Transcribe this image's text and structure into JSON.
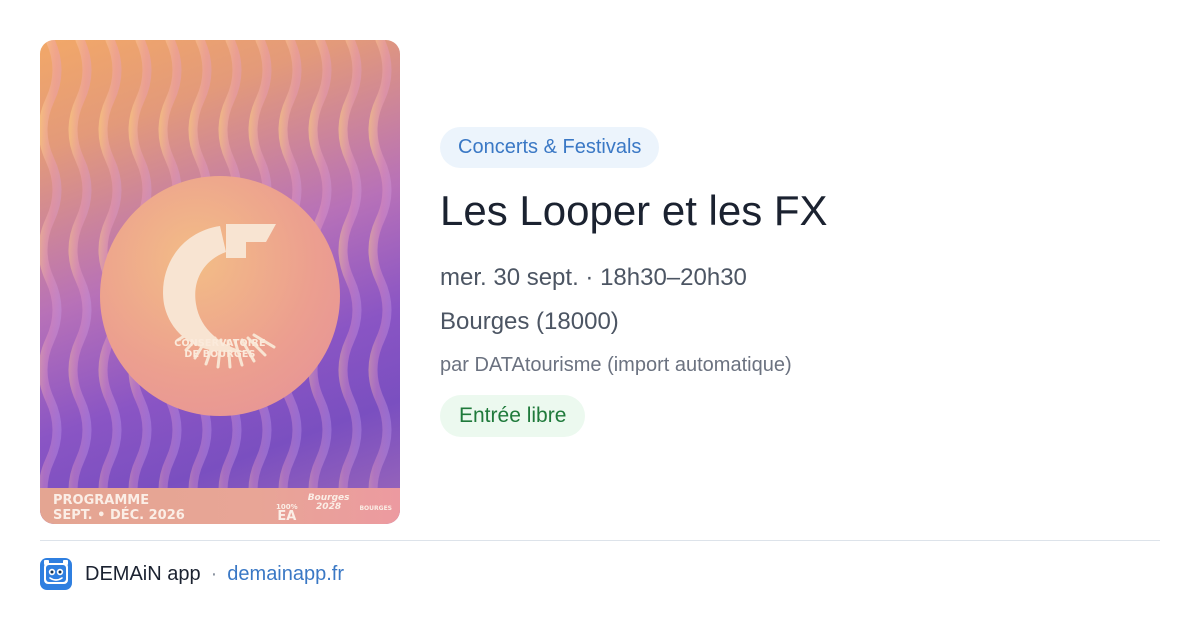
{
  "poster": {
    "org_name": "CONSERVATOIRE\nDE BOURGES",
    "programme": "PROGRAMME\nSEPT. • DÉC. 2026",
    "logo_ea_top": "100%",
    "logo_ea": "EA",
    "logo_bourges": "Bourges\n2028",
    "logo_ville": "BOURGES"
  },
  "event": {
    "category": "Concerts & Festivals",
    "title": "Les Looper et les FX",
    "datetime": "mer. 30 sept. · 18h30–20h30",
    "location": "Bourges (18000)",
    "source": "par DATAtourisme (import automatique)",
    "price": "Entrée libre"
  },
  "footer": {
    "app_name": "DEMAiN app",
    "separator": "·",
    "url": "demainapp.fr"
  },
  "colors": {
    "tag_bg": "#ecf4fc",
    "tag_text": "#3a78c5",
    "price_bg": "#ecf9ef",
    "price_text": "#1f7a3b",
    "title_text": "#1b2230",
    "link": "#3a78c5"
  },
  "icons": {
    "app": "demain-app-icon"
  }
}
